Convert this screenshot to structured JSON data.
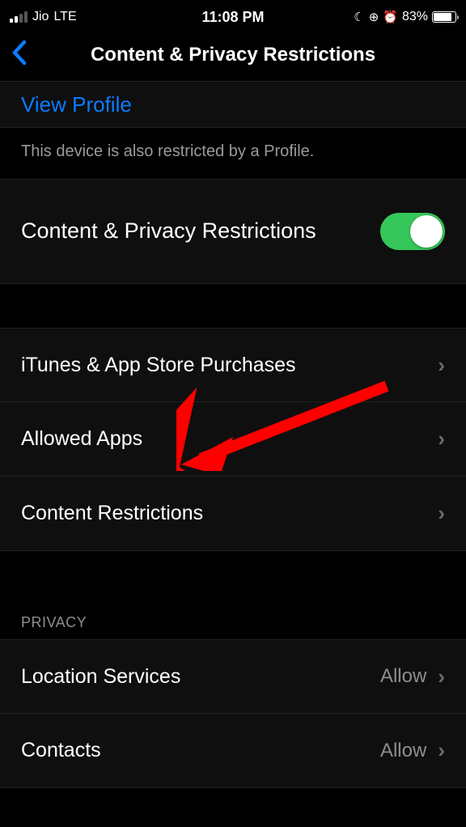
{
  "status_bar": {
    "carrier": "Jio",
    "network": "LTE",
    "time": "11:08 PM",
    "battery_percent": "83%"
  },
  "nav": {
    "title": "Content & Privacy Restrictions"
  },
  "view_profile": {
    "label": "View Profile"
  },
  "profile_note": "This device is also restricted by a Profile.",
  "main_toggle": {
    "label": "Content & Privacy Restrictions",
    "on": true
  },
  "rows": {
    "itunes": "iTunes & App Store Purchases",
    "allowed_apps": "Allowed Apps",
    "content_restrictions": "Content Restrictions"
  },
  "privacy_header": "PRIVACY",
  "privacy_rows": {
    "location": {
      "label": "Location Services",
      "value": "Allow"
    },
    "contacts": {
      "label": "Contacts",
      "value": "Allow"
    }
  }
}
